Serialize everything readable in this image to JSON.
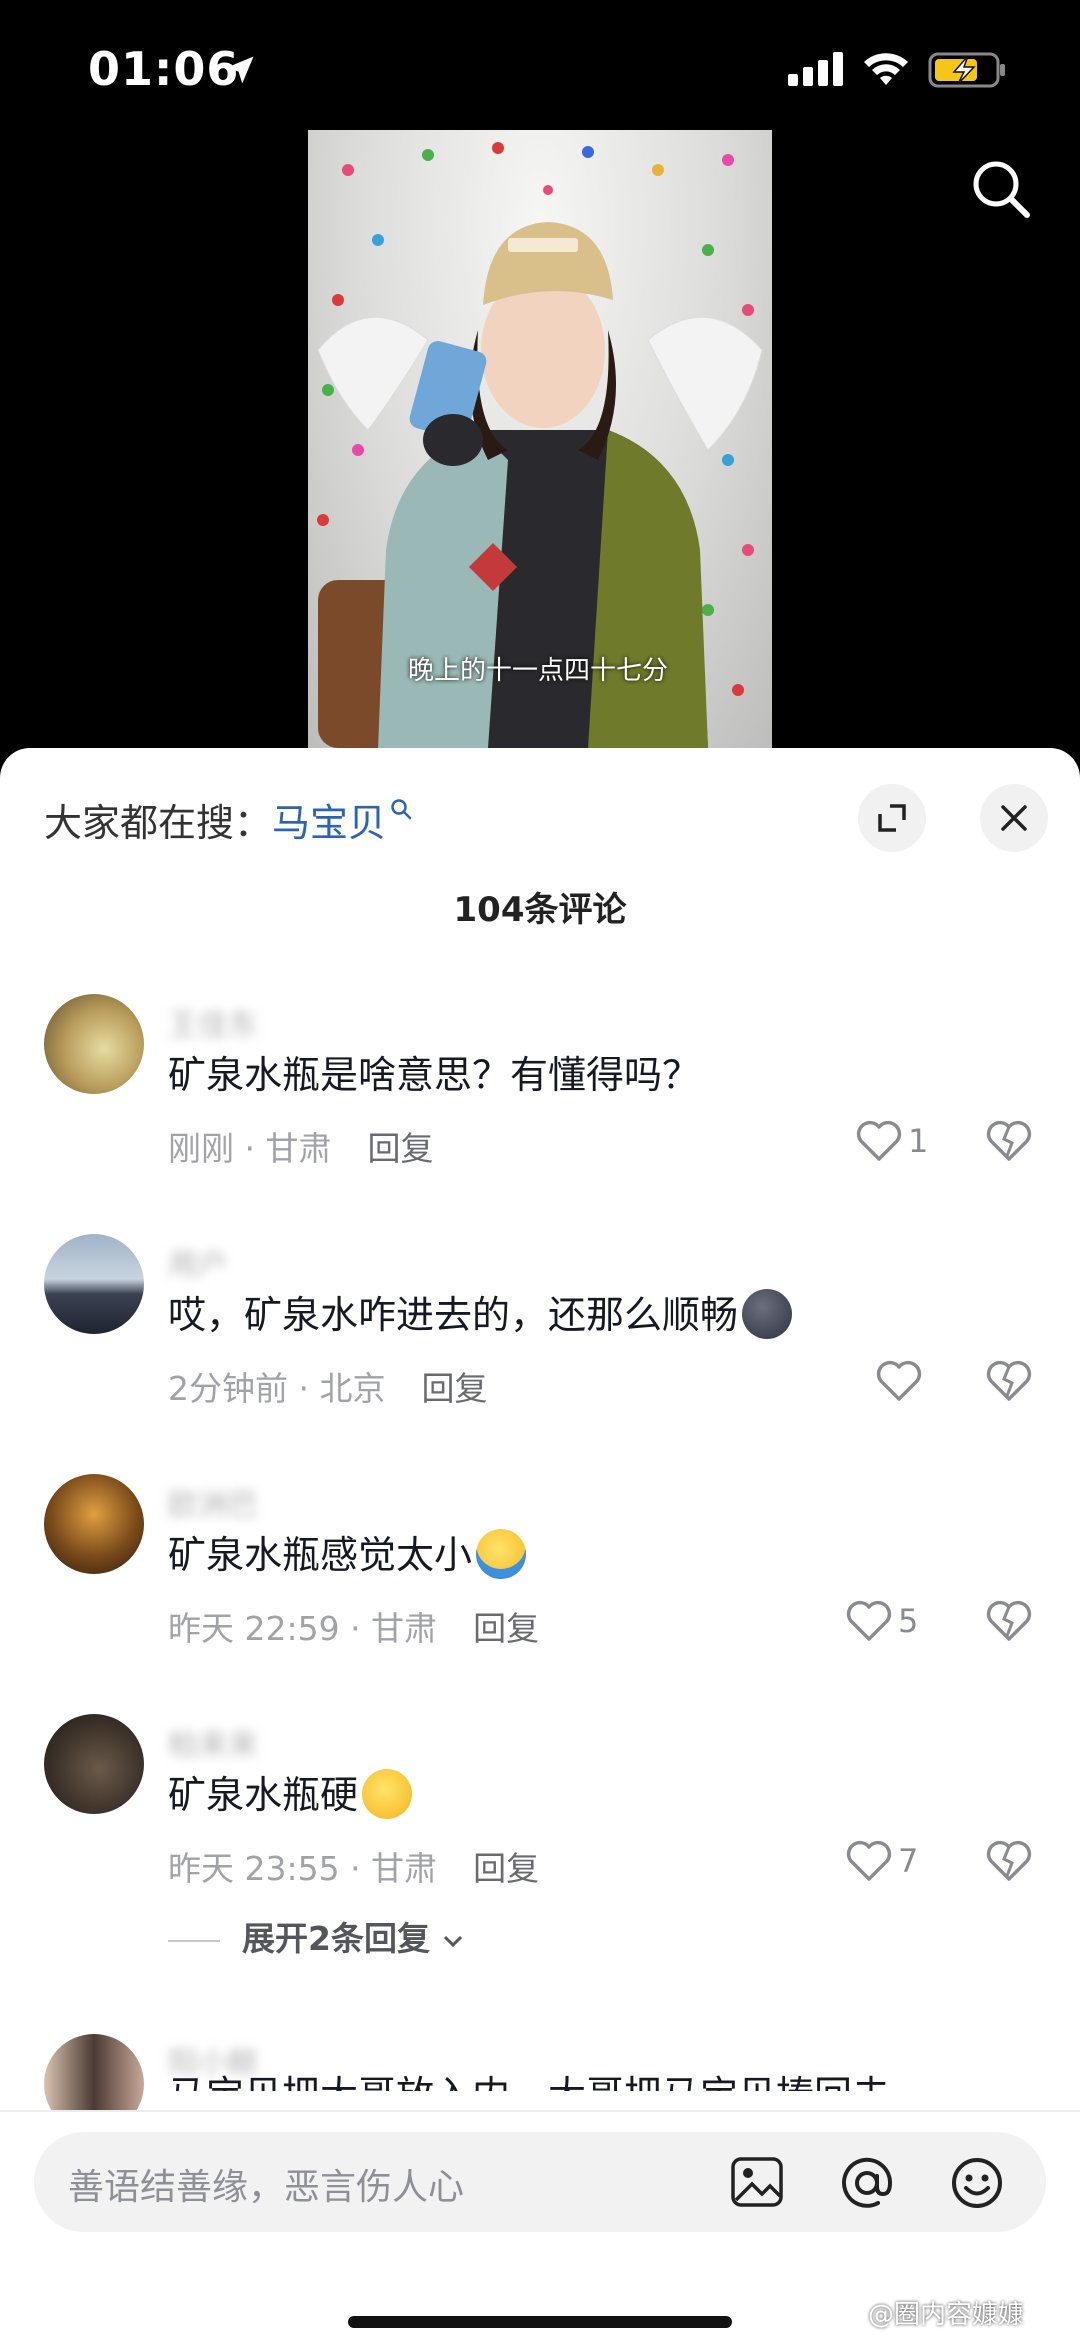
{
  "status_bar": {
    "time": "01:06"
  },
  "video": {
    "subtitle": "晚上的十一点四十七分"
  },
  "sheet": {
    "trending_label": "大家都在搜：",
    "trending_keyword": "马宝贝",
    "comment_count": "104条评论"
  },
  "comments": [
    {
      "username": "王佳东",
      "text": "矿泉水瓶是啥意思？有懂得吗？",
      "time_location": "刚刚 · 甘肃",
      "reply_label": "回复",
      "likes": "1"
    },
    {
      "username": "用户",
      "text": "哎，矿泉水咋进去的，还那么顺畅",
      "time_location": "2分钟前 · 北京",
      "reply_label": "回复",
      "likes": ""
    },
    {
      "username": "欧洲巴",
      "text": "矿泉水瓶感觉太小",
      "time_location": "昨天 22:59 · 甘肃",
      "reply_label": "回复",
      "likes": "5"
    },
    {
      "username": "柏来来",
      "text": "矿泉水瓶硬",
      "time_location": "昨天 23:55 · 甘肃",
      "reply_label": "回复",
      "likes": "7"
    }
  ],
  "expand_replies": "展开2条回复",
  "partial_comment": {
    "username": "阳小鲸",
    "text": "马宝贝把大哥放入内，大哥把马宝贝捧回去"
  },
  "input": {
    "placeholder": "善语结善缘，恶言伤人心"
  },
  "watermark": "@圈内容嫝嫝",
  "colors": {
    "keyword_blue": "#2b64b5",
    "battery_yellow": "#f5c518"
  }
}
